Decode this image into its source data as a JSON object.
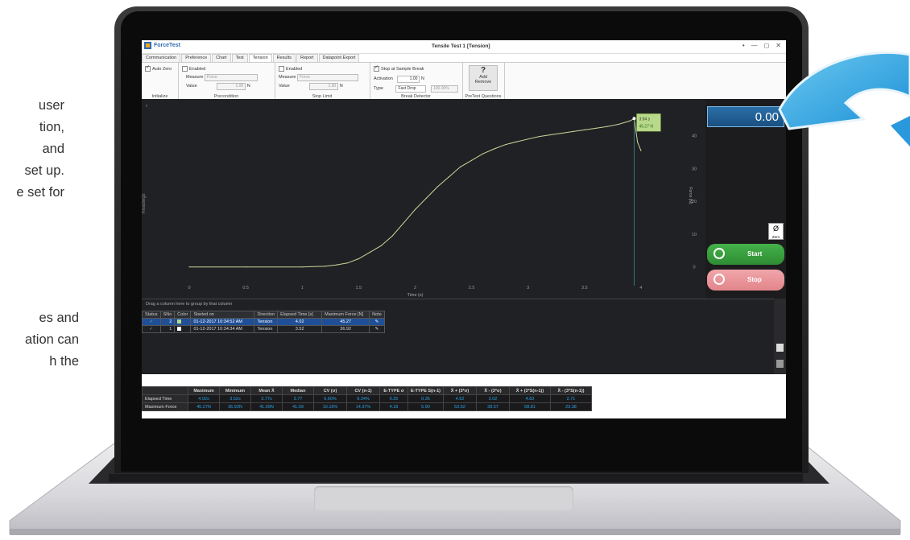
{
  "side_text_top": [
    "user",
    "tion,",
    "and",
    "set up.",
    "e set for"
  ],
  "side_text_bottom": [
    "es and",
    "ation can",
    "h the"
  ],
  "app": {
    "name": "ForceTest",
    "window_title": "Tensile Test 1 [Tension]",
    "window_controls": [
      "•",
      "—",
      "◻",
      "✕"
    ]
  },
  "tabs": [
    "Communication",
    "Preference",
    "Chart",
    "Test",
    "Tension",
    "Results",
    "Report",
    "Datapoint Export"
  ],
  "active_tab": "Tension",
  "ribbon": {
    "initialize": {
      "title": "Initialize",
      "auto_zero": "Auto Zero"
    },
    "precondition": {
      "title": "Precondition",
      "enabled": "Enabled",
      "measure_label": "Measure",
      "measure_value": "Force",
      "value_label": "Value",
      "value": "1.00",
      "unit": "N"
    },
    "stop_limit": {
      "title": "Stop Limit",
      "enabled": "Enabled",
      "measure_label": "Measure",
      "measure_value": "Force",
      "value_label": "Value",
      "value": "1.00",
      "unit": "N"
    },
    "break_detector": {
      "title": "Break Detector",
      "stop_at_break": "Stop at Sample Break",
      "activation_label": "Activation",
      "activation_value": "1.00",
      "unit": "N",
      "type_label": "Type",
      "type_value": "Fast Drop",
      "percent": "100.00%"
    },
    "pretest": {
      "title": "PreTest Questions",
      "add": "Add",
      "remove": "Remove"
    }
  },
  "chart_data": {
    "type": "line",
    "x_ticks": [
      "0",
      "0.5",
      "1",
      "1.5",
      "2",
      "2.5",
      "3",
      "3.5",
      "4"
    ],
    "y_ticks": [
      "0",
      "10",
      "20",
      "30",
      "40"
    ],
    "xlabel": "Time (s)",
    "ylabel": "Force (N)",
    "left_label": "Readings",
    "xlim": [
      -0.35,
      4.5
    ],
    "ylim": [
      -4,
      50
    ],
    "series": [
      {
        "color": "#c8d89a",
        "x": [
          0,
          0.5,
          1.0,
          1.2,
          1.3,
          1.4,
          1.5,
          1.6,
          1.7,
          1.8,
          1.9,
          2.0,
          2.1,
          2.2,
          2.3,
          2.4,
          2.5,
          2.6,
          2.7,
          2.8,
          2.9,
          3.0,
          3.1,
          3.2,
          3.3,
          3.4,
          3.5,
          3.6,
          3.7,
          3.8,
          3.9,
          3.94,
          3.97,
          4.0
        ],
        "y": [
          0,
          0,
          0,
          0.2,
          0.6,
          1.2,
          2.5,
          4.5,
          6.5,
          9.5,
          13.5,
          17.5,
          21,
          24.5,
          27.5,
          30.5,
          32.5,
          34.5,
          36,
          37.3,
          38.2,
          39,
          39.8,
          40.3,
          40.8,
          41.3,
          41.8,
          42.3,
          42.8,
          43.5,
          44.5,
          45.27,
          38,
          35.5
        ]
      }
    ],
    "annotation": {
      "x": "3.94 s",
      "y": "45.27 N"
    }
  },
  "readout": "0.00",
  "zero_label": "Zero",
  "start_label": "Start",
  "stop_label": "Stop",
  "table": {
    "group_hint": "Drag a column here to group by that column",
    "headers": [
      "Status",
      "SNo",
      "Color",
      "Started on",
      "Direction",
      "Elapsed Time [s]",
      "Maximum Force [N]",
      "Note"
    ],
    "rows": [
      {
        "status": "✓",
        "sno": "2",
        "color": "#b9d98a",
        "started": "01-12-2017 10:34:52 AM",
        "direction": "Tension",
        "elapsed": "4.02",
        "max_force": "45.27",
        "note": "✎"
      },
      {
        "status": "✓",
        "sno": "1",
        "color": "#ffffff",
        "started": "01-12-2017 10:34:34 AM",
        "direction": "Tension",
        "elapsed": "3.52",
        "max_force": "36.92",
        "note": "✎"
      }
    ]
  },
  "stats": {
    "headers": [
      "Maximum",
      "Minimum",
      "Mean X̄",
      "Median",
      "CV (σ)",
      "CV (n-1)",
      "E-TYPE σ",
      "E-TYPE S(n-1)",
      "X̄ + (3*σ)",
      "X̄ - (3*σ)",
      "X̄ + (3*S(n-1))",
      "X̄ - (3*S(n-1))"
    ],
    "rows": [
      {
        "label": "Elapsed Time",
        "values": [
          "4.02s",
          "3.52s",
          "3.77s",
          "3.77",
          "6.60%",
          "9.34%",
          "0.25",
          "0.35",
          "4.52",
          "3.02",
          "4.83",
          "2.71"
        ]
      },
      {
        "label": "Maximum Force",
        "values": [
          "45.27N",
          "36.92N",
          "41.09N",
          "41.09",
          "10.16%",
          "14.37%",
          "4.18",
          "5.90",
          "53.62",
          "28.57",
          "58.81",
          "23.38"
        ]
      }
    ]
  }
}
